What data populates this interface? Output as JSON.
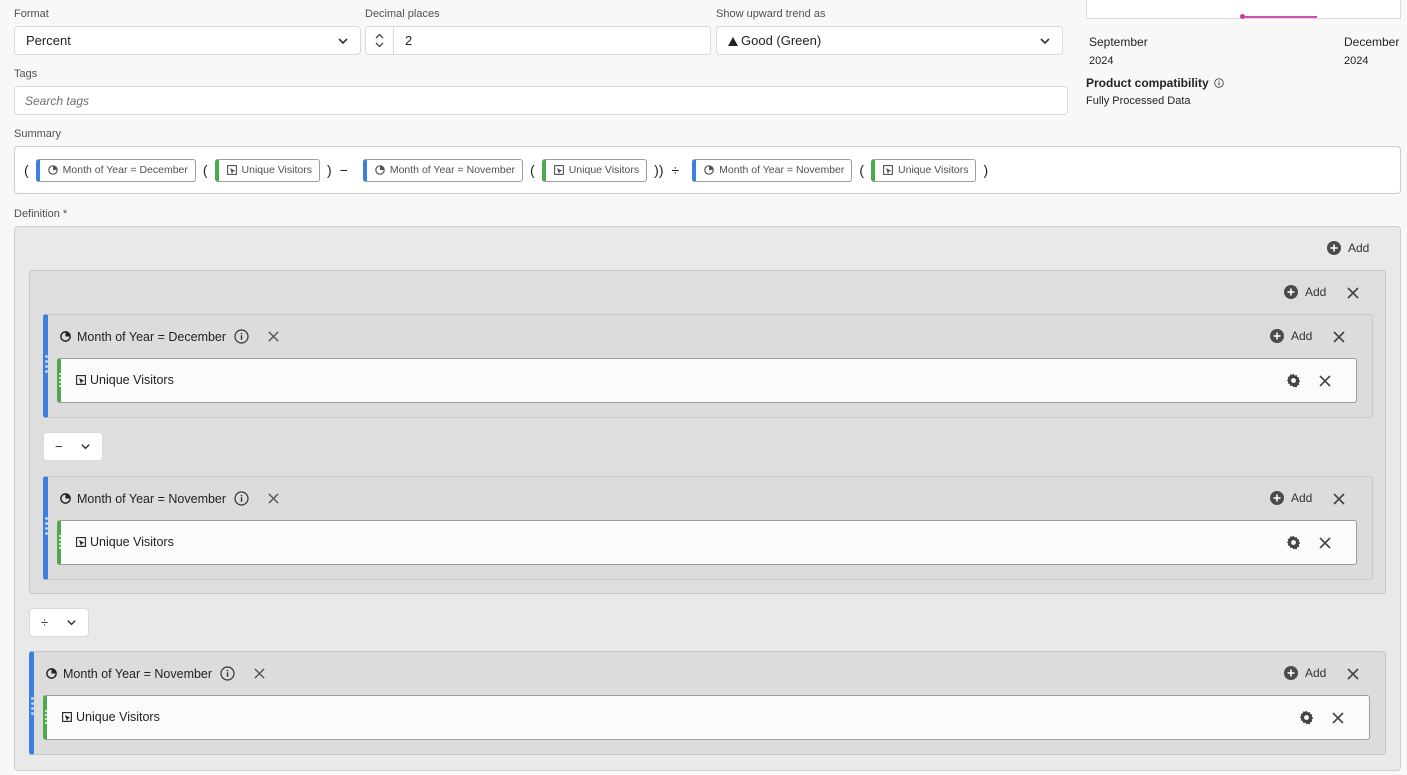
{
  "format": {
    "label": "Format",
    "value": "Percent"
  },
  "decimal": {
    "label": "Decimal places",
    "value": "2"
  },
  "trend": {
    "label": "Show upward trend as",
    "value": "Good (Green)"
  },
  "tags": {
    "label": "Tags",
    "placeholder": "Search tags"
  },
  "preview": {
    "start_month": "September",
    "start_year": "2024",
    "end_month": "December",
    "end_year": "2024",
    "compat_label": "Product compatibility",
    "compat_value": "Fully Processed Data"
  },
  "summary": {
    "label": "Summary",
    "seg_dec": "Month of Year = December",
    "seg_nov": "Month of Year = November",
    "metric": "Unique Visitors",
    "open": "(",
    "close": ")",
    "close2": "))",
    "minus": "−",
    "divide": "÷"
  },
  "definition": {
    "label": "Definition",
    "required_mark": "*",
    "add_label": "Add",
    "operator_minus": "−",
    "operator_divide": "÷",
    "seg_dec": "Month of Year = December",
    "seg_nov": "Month of Year = November",
    "metric": "Unique Visitors"
  },
  "colors": {
    "segment": "#3c7fe0",
    "metric": "#4ea84e",
    "trend_line": "#d050b0"
  }
}
